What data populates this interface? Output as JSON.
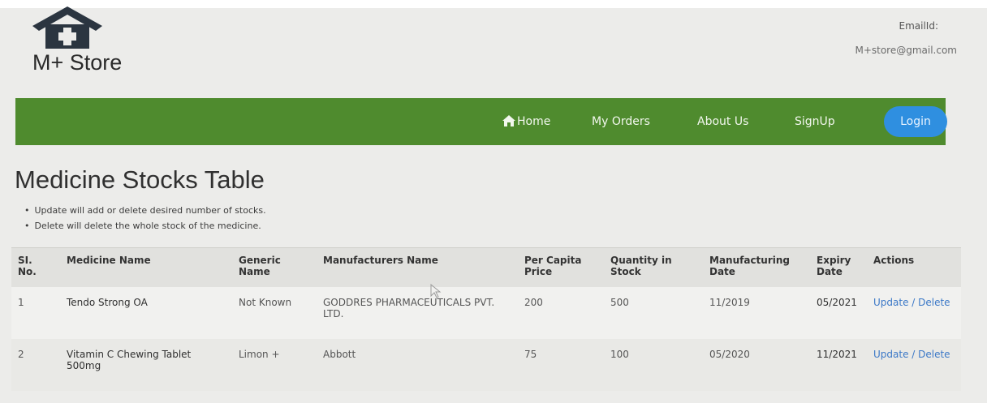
{
  "brand": {
    "name": "M+ Store"
  },
  "contact": {
    "email_label": "EmailId:",
    "email_value": "M+store@gmail.com"
  },
  "nav": {
    "items": [
      {
        "label": "Home",
        "icon": "home-icon"
      },
      {
        "label": "My Orders"
      },
      {
        "label": "About Us"
      },
      {
        "label": "SignUp"
      }
    ],
    "login_label": "Login"
  },
  "page": {
    "title": "Medicine Stocks Table",
    "notes": [
      "Update will add or delete desired number of stocks.",
      "Delete will delete the whole stock of the medicine."
    ]
  },
  "table": {
    "headers": [
      "SI. No.",
      "Medicine Name",
      "Generic Name",
      "Manufacturers Name",
      "Per Capita Price",
      "Quantity in Stock",
      "Manufacturing Date",
      "Expiry Date",
      "Actions"
    ],
    "rows": [
      {
        "sl": "1",
        "medicine": "Tendo Strong OA",
        "generic": "Not Known",
        "manufacturer": "GODDRES PHARMACEUTICALS PVT. LTD.",
        "price": "200",
        "quantity": "500",
        "mfg_date": "11/2019",
        "expiry": "05/2021",
        "actions": "Update / Delete"
      },
      {
        "sl": "2",
        "medicine": "Vitamin C Chewing Tablet 500mg",
        "generic": "Limon +",
        "manufacturer": "Abbott",
        "price": "75",
        "quantity": "100",
        "mfg_date": "05/2020",
        "expiry": "11/2021",
        "actions": "Update / Delete"
      }
    ]
  },
  "colors": {
    "nav_green": "#4f8b2e",
    "login_blue": "#2f8fe0",
    "link_blue": "#3b78c7"
  }
}
